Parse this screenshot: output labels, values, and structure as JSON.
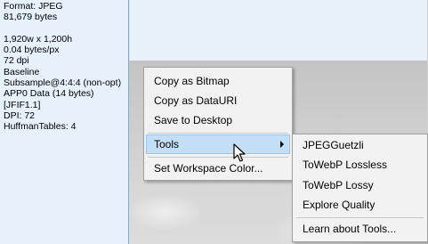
{
  "info_panel": {
    "lines": [
      "Format: JPEG",
      "81,679 bytes",
      "",
      "1,920w x 1,200h",
      "0.04 bytes/px",
      "72 dpi",
      "Baseline",
      "Subsample@4:4:4 (non-opt)",
      "APP0 Data (14 bytes)",
      "[JFIF1.1]",
      "DPI: 72",
      "HuffmanTables: 4"
    ]
  },
  "context_menu": {
    "items": [
      {
        "label": "Copy as Bitmap",
        "mnemonic": "B"
      },
      {
        "label": "Copy as DataURI",
        "mnemonic": "D"
      },
      {
        "label": "Save to Desktop",
        "mnemonic": "S"
      },
      {
        "label": "Tools",
        "mnemonic": "T",
        "has_submenu": true,
        "highlighted": true
      },
      {
        "label": "Set Workspace Color...",
        "mnemonic": "W"
      }
    ]
  },
  "tools_submenu": {
    "items": [
      {
        "label": "JPEGGuetzli",
        "mnemonic": "J"
      },
      {
        "label": "ToWebP Lossless",
        "mnemonic": "W"
      },
      {
        "label": "ToWebP Lossy",
        "mnemonic": "W"
      },
      {
        "label": "Explore Quality",
        "mnemonic": "Q"
      },
      {
        "label": "Learn about Tools...",
        "mnemonic": "L"
      }
    ]
  },
  "colors": {
    "info_bg": "#e6f1fb",
    "menu_bg": "#f2f2f2",
    "highlight_bg": "#c4def6",
    "highlight_border": "#99c6f0"
  },
  "icons": [
    "submenu-arrow-icon",
    "mouse-cursor-icon"
  ]
}
